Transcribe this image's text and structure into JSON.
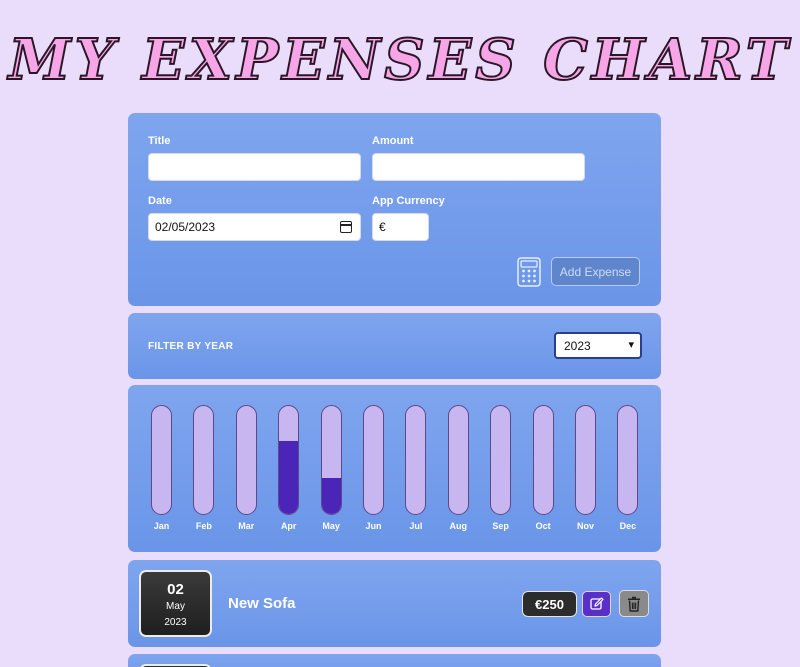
{
  "app": {
    "title": "MY EXPENSES CHART"
  },
  "form": {
    "title_label": "Title",
    "title_value": "",
    "amount_label": "Amount",
    "amount_value": "",
    "date_label": "Date",
    "date_value": "02/05/2023",
    "currency_label": "App Currency",
    "currency_value": "€",
    "calculator_icon": "calculator-icon",
    "add_button_label": "Add Expense"
  },
  "filter": {
    "label": "FILTER BY YEAR",
    "selected_year": "2023",
    "chevron": "▾"
  },
  "chart_data": {
    "type": "bar",
    "categories": [
      "Jan",
      "Feb",
      "Mar",
      "Apr",
      "May",
      "Jun",
      "Jul",
      "Aug",
      "Sep",
      "Oct",
      "Nov",
      "Dec"
    ],
    "values": [
      0,
      0,
      0,
      0.68,
      0.33,
      0,
      0,
      0,
      0,
      0,
      0,
      0
    ],
    "value_unit": "fraction of max",
    "colors": {
      "track": "#c7b6f0",
      "fill": "#4b24b8"
    }
  },
  "expenses": [
    {
      "day": "02",
      "month": "May",
      "year": "2023",
      "title": "New Sofa",
      "amount": "€250",
      "edit_icon": "edit-icon",
      "delete_icon": "trash-icon"
    }
  ]
}
